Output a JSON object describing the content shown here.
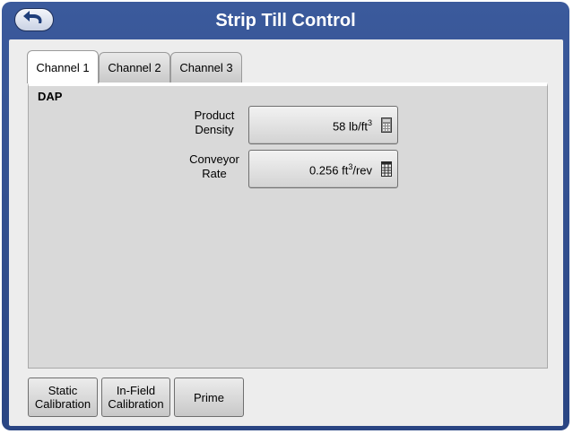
{
  "window": {
    "title": "Strip Till Control",
    "back_icon": "back-arrow-icon"
  },
  "tabs": [
    {
      "label": "Channel 1",
      "active": true
    },
    {
      "label": "Channel 2",
      "active": false
    },
    {
      "label": "Channel 3",
      "active": false
    }
  ],
  "panel": {
    "product_name": "DAP",
    "fields": [
      {
        "label_line1": "Product",
        "label_line2": "Density",
        "value": "58 lb/ft",
        "value_sup": "3",
        "value_suffix": "",
        "icon": "calculator-icon"
      },
      {
        "label_line1": "Conveyor",
        "label_line2": "Rate",
        "value": "0.256 ft",
        "value_sup": "3",
        "value_suffix": "/rev",
        "icon": "table-icon"
      }
    ]
  },
  "buttons": {
    "static_calibration_line1": "Static",
    "static_calibration_line2": "Calibration",
    "infield_calibration_line1": "In-Field",
    "infield_calibration_line2": "Calibration",
    "prime": "Prime"
  },
  "colors": {
    "frame": "#2f4d8f",
    "title_text": "#ffffff",
    "client_bg": "#ededed",
    "panel_bg": "#d9d9d9"
  }
}
